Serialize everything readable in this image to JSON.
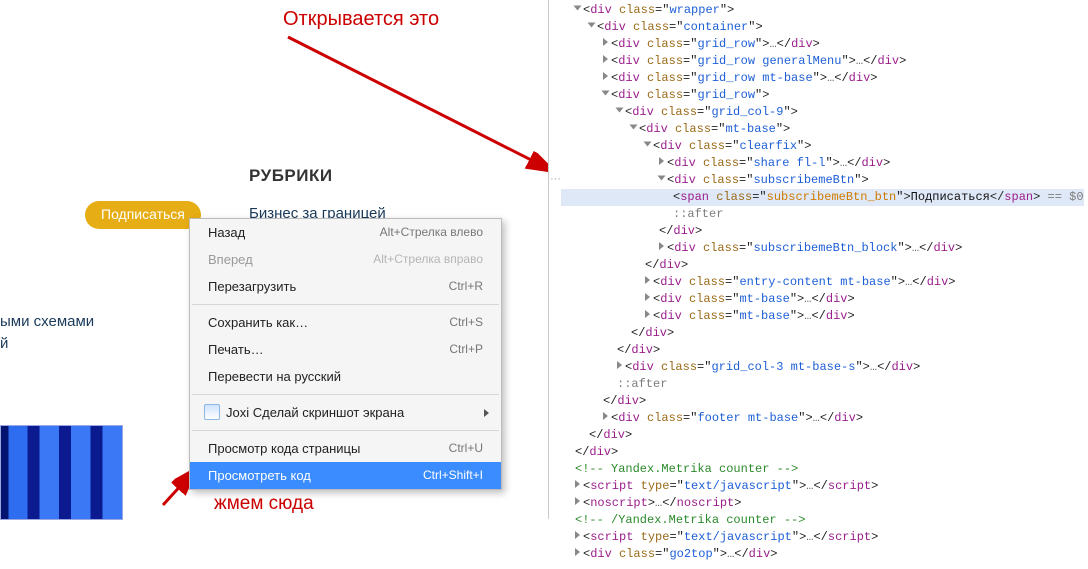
{
  "annotations": {
    "top": "Открывается это",
    "bottom": "жмем сюда"
  },
  "page": {
    "heading": "РУБРИКИ",
    "link1": "Бизнес за границей",
    "subscribe": "Подписаться",
    "cut_line1": "ыми схемами",
    "cut_line2": "й"
  },
  "ctx": {
    "items": [
      {
        "label": "Назад",
        "shortcut": "Alt+Стрелка влево",
        "dis": false
      },
      {
        "label": "Вперед",
        "shortcut": "Alt+Стрелка вправо",
        "dis": true
      },
      {
        "label": "Перезагрузить",
        "shortcut": "Ctrl+R",
        "dis": false
      }
    ],
    "items2": [
      {
        "label": "Сохранить как…",
        "shortcut": "Ctrl+S"
      },
      {
        "label": "Печать…",
        "shortcut": "Ctrl+P"
      },
      {
        "label": "Перевести на русский",
        "shortcut": ""
      }
    ],
    "joxi": "Joxi Сделай скриншот экрана",
    "items3": [
      {
        "label": "Просмотр кода страницы",
        "shortcut": "Ctrl+U"
      }
    ],
    "inspect": {
      "label": "Просмотреть код",
      "shortcut": "Ctrl+Shift+I"
    }
  },
  "dom": {
    "subscribe_text": "Подписаться",
    "eq0": " == $0",
    "after": "::after",
    "comment1": "<!-- Yandex.Metrika counter -->",
    "comment2": "<!-- /Yandex.Metrika counter -->",
    "lines": {
      "l1": {
        "cls": "wrapper"
      },
      "l2": {
        "cls": "container"
      },
      "l3": {
        "cls": "grid_row"
      },
      "l4": {
        "cls": "grid_row generalMenu"
      },
      "l5": {
        "cls": "grid_row mt-base"
      },
      "l6": {
        "cls": "grid_row"
      },
      "l7": {
        "cls": "grid_col-9"
      },
      "l8": {
        "cls": "mt-base"
      },
      "l9": {
        "cls": "clearfix"
      },
      "l10": {
        "cls": "share fl-l"
      },
      "l11": {
        "cls": "subscribemeBtn"
      },
      "l12": {
        "cls": "subscribemeBtn_btn"
      },
      "l13": {
        "cls": "subscribemeBtn_block"
      },
      "l14": {
        "cls": "entry-content mt-base"
      },
      "l15": {
        "cls": "mt-base"
      },
      "l16": {
        "cls": "mt-base"
      },
      "l17": {
        "cls": "grid_col-3 mt-base-s"
      },
      "l18": {
        "cls": "footer mt-base"
      },
      "l19": {
        "cls": "go2top"
      },
      "scriptType": "text/javascript"
    }
  }
}
